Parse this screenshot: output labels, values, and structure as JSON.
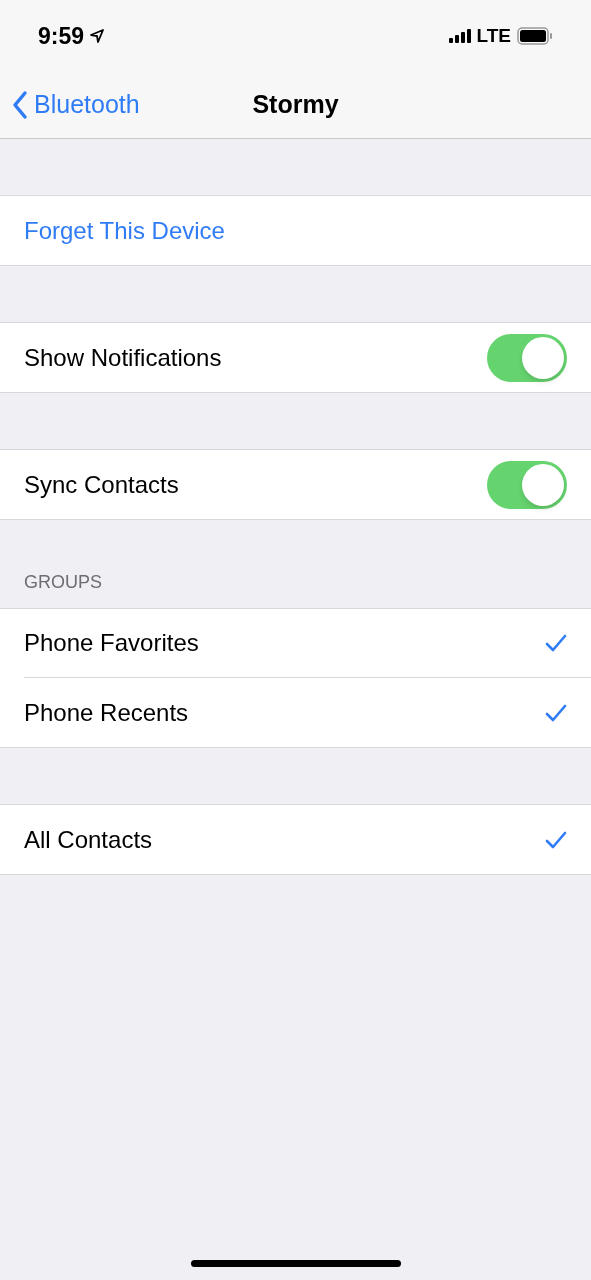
{
  "status_bar": {
    "time": "9:59",
    "network": "LTE"
  },
  "nav": {
    "back": "Bluetooth",
    "title": "Stormy"
  },
  "sections": [
    {
      "rows": [
        {
          "kind": "action",
          "label": "Forget This Device"
        }
      ]
    },
    {
      "rows": [
        {
          "kind": "toggle",
          "label": "Show Notifications",
          "on": true
        }
      ]
    },
    {
      "rows": [
        {
          "kind": "toggle",
          "label": "Sync Contacts",
          "on": true
        }
      ]
    },
    {
      "header": "GROUPS",
      "rows": [
        {
          "kind": "check",
          "label": "Phone Favorites",
          "checked": true
        },
        {
          "kind": "check",
          "label": "Phone Recents",
          "checked": true
        }
      ]
    },
    {
      "rows": [
        {
          "kind": "check",
          "label": "All Contacts",
          "checked": true
        }
      ]
    }
  ]
}
